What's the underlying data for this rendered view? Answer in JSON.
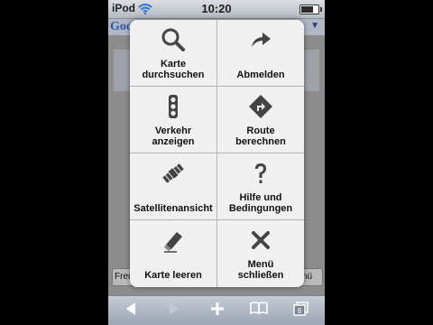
{
  "status_bar": {
    "carrier": "iPod",
    "time": "10:20",
    "battery_level": 0.7
  },
  "page": {
    "logo_text": "Google",
    "left_button_label": "Freu",
    "right_button_label": "nü"
  },
  "menu": {
    "items": [
      {
        "label": "Karte\ndurchsuchen",
        "icon": "search-icon"
      },
      {
        "label": "Abmelden",
        "icon": "arrow-icon"
      },
      {
        "label": "Verkehr\nanzeigen",
        "icon": "traffic-light-icon"
      },
      {
        "label": "Route\nberechnen",
        "icon": "route-sign-icon"
      },
      {
        "label": "Satellitenansicht",
        "icon": "satellite-icon"
      },
      {
        "label": "Hilfe und\nBedingungen",
        "icon": "help-icon"
      },
      {
        "label": "Karte leeren",
        "icon": "eraser-icon"
      },
      {
        "label": "Menü\nschließen",
        "icon": "close-icon"
      }
    ]
  },
  "toolbar": {
    "items": [
      "back",
      "forward",
      "add",
      "bookmarks",
      "pages"
    ],
    "pages_count": "8"
  }
}
